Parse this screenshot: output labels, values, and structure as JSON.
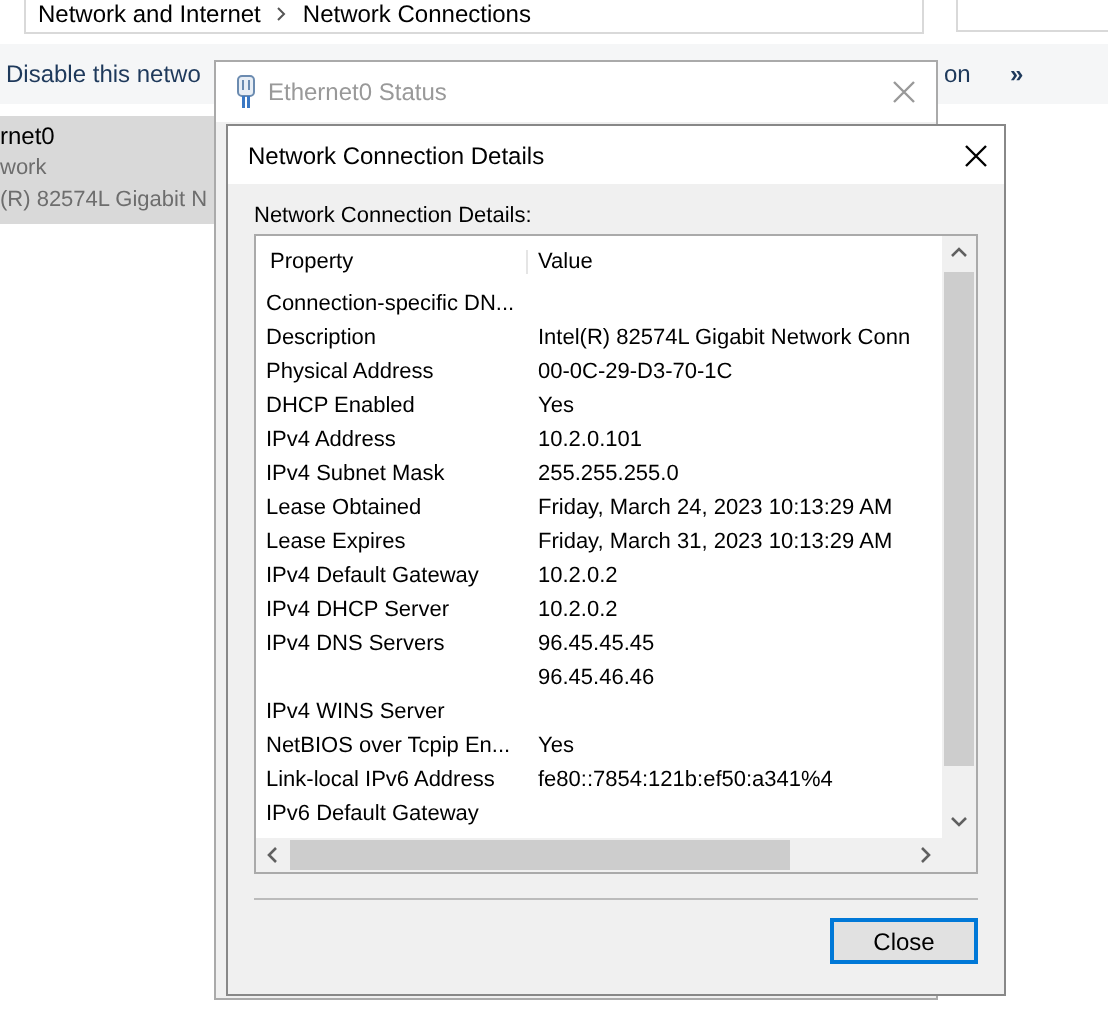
{
  "explorer": {
    "breadcrumb": [
      "Network and Internet",
      "Network Connections"
    ],
    "toolbar": [
      {
        "kind": "text",
        "label": "Disable this netwo"
      },
      {
        "kind": "text",
        "label": "on"
      },
      {
        "kind": "more",
        "label": "»"
      }
    ],
    "items": [
      {
        "name": "rnet0",
        "network": "work",
        "device": "(R) 82574L Gigabit N",
        "selected": true
      }
    ]
  },
  "status_window": {
    "title": "Ethernet0 Status"
  },
  "details_dialog": {
    "title": "Network Connection Details",
    "label": "Network Connection Details:",
    "columns": [
      "Property",
      "Value"
    ],
    "rows": [
      {
        "property": "Connection-specific DN..."
      },
      {
        "property": "Description",
        "value": "Intel(R) 82574L Gigabit Network Conn"
      },
      {
        "property": "Physical Address",
        "value": "00-0C-29-D3-70-1C"
      },
      {
        "property": "DHCP Enabled",
        "value": "Yes"
      },
      {
        "property": "IPv4 Address",
        "value": "10.2.0.101"
      },
      {
        "property": "IPv4 Subnet Mask",
        "value": "255.255.255.0"
      },
      {
        "property": "Lease Obtained",
        "value": "Friday, March 24, 2023 10:13:29 AM"
      },
      {
        "property": "Lease Expires",
        "value": "Friday, March 31, 2023 10:13:29 AM"
      },
      {
        "property": "IPv4 Default Gateway",
        "value": "10.2.0.2"
      },
      {
        "property": "IPv4 DHCP Server",
        "value": "10.2.0.2"
      },
      {
        "property": "IPv4 DNS Servers",
        "value": "96.45.45.45"
      },
      {
        "value": "96.45.46.46"
      },
      {
        "property": "IPv4 WINS Server"
      },
      {
        "property": "NetBIOS over Tcpip En...",
        "value": "Yes"
      },
      {
        "property": "Link-local IPv6 Address",
        "value": "fe80::7854:121b:ef50:a341%4"
      },
      {
        "property": "IPv6 Default Gateway"
      }
    ],
    "buttons": [
      "Close"
    ]
  }
}
